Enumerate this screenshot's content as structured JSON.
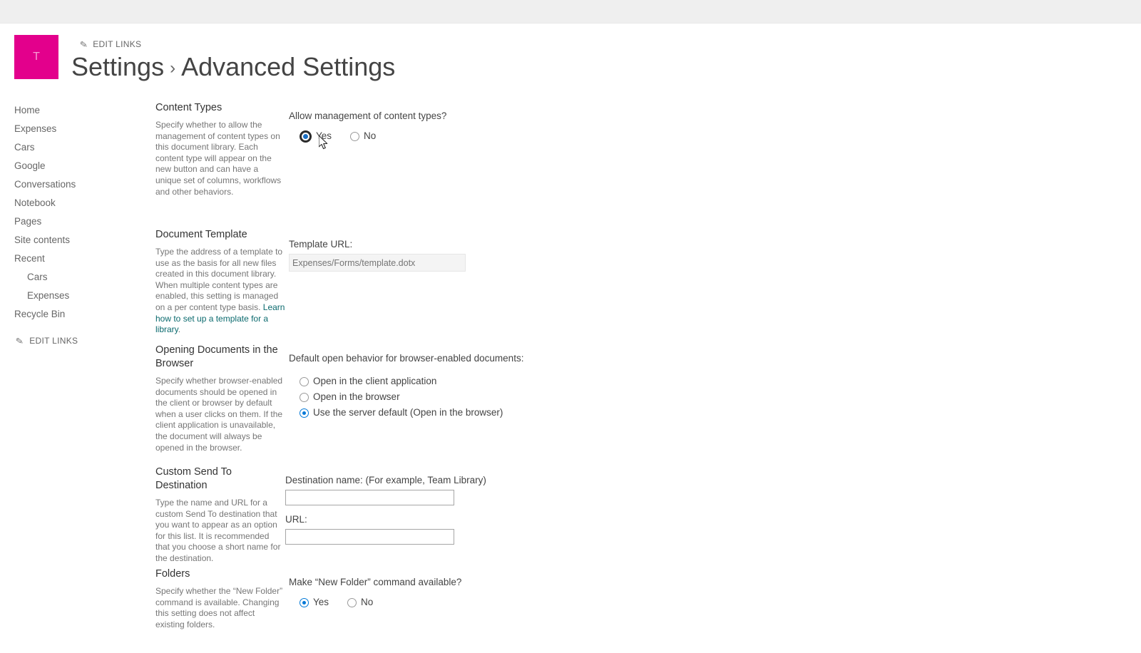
{
  "header": {
    "logo_letter": "T",
    "edit_links_top": "EDIT LINKS",
    "breadcrumb_parent": "Settings",
    "breadcrumb_separator": "›",
    "breadcrumb_current": "Advanced Settings",
    "logo_color": "#e3008c"
  },
  "sidebar": {
    "items": [
      {
        "label": "Home",
        "sub": false
      },
      {
        "label": "Expenses",
        "sub": false
      },
      {
        "label": "Cars",
        "sub": false
      },
      {
        "label": "Google",
        "sub": false
      },
      {
        "label": "Conversations",
        "sub": false
      },
      {
        "label": "Notebook",
        "sub": false
      },
      {
        "label": "Pages",
        "sub": false
      },
      {
        "label": "Site contents",
        "sub": false
      },
      {
        "label": "Recent",
        "sub": false
      },
      {
        "label": "Cars",
        "sub": true
      },
      {
        "label": "Expenses",
        "sub": true
      },
      {
        "label": "Recycle Bin",
        "sub": false
      }
    ],
    "edit_links_bottom": "EDIT LINKS"
  },
  "sections": {
    "content_types": {
      "heading": "Content Types",
      "description": "Specify whether to allow the management of content types on this document library. Each content type will appear on the new button and can have a unique set of columns, workflows and other behaviors.",
      "question": "Allow management of content types?",
      "options": [
        {
          "label": "Yes",
          "checked": true,
          "focused": true
        },
        {
          "label": "No",
          "checked": false,
          "focused": false
        }
      ]
    },
    "document_template": {
      "heading": "Document Template",
      "description_part1": "Type the address of a template to use as the basis for all new files created in this document library. When multiple content types are enabled, this setting is managed on a per content type basis. ",
      "link_text": "Learn how to set up a template for a library",
      "description_part2": ".",
      "field_label": "Template URL:",
      "field_value": "",
      "field_placeholder": "Expenses/Forms/template.dotx",
      "field_disabled": true
    },
    "opening_documents": {
      "heading": "Opening Documents in the Browser",
      "description": "Specify whether browser-enabled documents should be opened in the client or browser by default when a user clicks on them. If the client application is unavailable, the document will always be opened in the browser.",
      "question": "Default open behavior for browser-enabled documents:",
      "options": [
        {
          "label": "Open in the client application",
          "checked": false
        },
        {
          "label": "Open in the browser",
          "checked": false
        },
        {
          "label": "Use the server default (Open in the browser)",
          "checked": true
        }
      ]
    },
    "custom_send_to": {
      "heading": "Custom Send To Destination",
      "description": "Type the name and URL for a custom Send To destination that you want to appear as an option for this list. It is recommended that you choose a short name for the destination.",
      "destination_label": "Destination name: (For example, Team Library)",
      "destination_value": "",
      "url_label": "URL:",
      "url_value": ""
    },
    "folders": {
      "heading": "Folders",
      "description": "Specify whether the “New Folder” command is available. Changing this setting does not affect existing folders.",
      "question": "Make “New Folder” command available?",
      "options": [
        {
          "label": "Yes",
          "checked": true
        },
        {
          "label": "No",
          "checked": false
        }
      ]
    }
  }
}
